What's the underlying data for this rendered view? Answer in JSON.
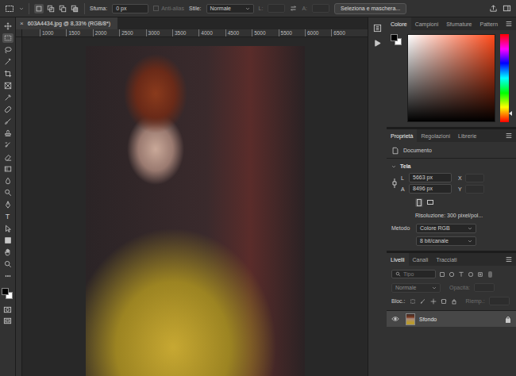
{
  "options_bar": {
    "selection_modes": [
      {
        "selected": true
      },
      {
        "selected": false
      },
      {
        "selected": false
      },
      {
        "selected": false
      }
    ],
    "feather_label": "Sfuma:",
    "feather_value": "0 px",
    "antialias": {
      "label": "Anti-alias",
      "disabled": true
    },
    "style_label": "Stile:",
    "style_value": "Normale",
    "width": {
      "label": "L:",
      "disabled": true
    },
    "height": {
      "label": "A:",
      "disabled": true
    },
    "mask_button": "Seleziona e maschera..."
  },
  "document_tab": {
    "title": "603A4434.jpg @ 8,33% (RGB/8*)",
    "close": "×"
  },
  "ruler": {
    "ticks": [
      "1000",
      "1500",
      "2000",
      "2500",
      "3000",
      "3500",
      "4000",
      "4500",
      "5000",
      "5500",
      "6000",
      "6500"
    ]
  },
  "toolbar": {
    "tools": [
      {
        "selected": false
      },
      {
        "selected": true
      },
      {
        "selected": false
      },
      {
        "selected": false
      },
      {
        "selected": false
      },
      {
        "selected": false
      },
      {
        "selected": false
      },
      {
        "selected": false
      },
      {
        "selected": false
      },
      {
        "selected": false
      },
      {
        "selected": false
      },
      {
        "selected": false
      },
      {
        "selected": false
      },
      {
        "selected": false
      },
      {
        "selected": false
      },
      {
        "selected": false
      },
      {
        "selected": false,
        "glyph": "T"
      },
      {
        "selected": false
      },
      {
        "selected": false
      },
      {
        "selected": false
      },
      {
        "selected": false
      },
      {
        "selected": false
      }
    ]
  },
  "color_panel": {
    "tabs": [
      {
        "label": "Colore",
        "selected": true
      },
      {
        "label": "Campioni",
        "selected": false
      },
      {
        "label": "Sfumature",
        "selected": false
      },
      {
        "label": "Pattern",
        "selected": false
      }
    ],
    "foreground": "#000000",
    "background": "#ffffff",
    "hue": {
      "level": 0.9
    }
  },
  "properties_panel": {
    "tabs": [
      {
        "label": "Proprietà",
        "selected": true
      },
      {
        "label": "Regolazioni",
        "selected": false
      },
      {
        "label": "Librerie",
        "selected": false
      }
    ],
    "section": "Documento",
    "canvas": {
      "title": "Tela",
      "width_label": "L",
      "width": "5663 px",
      "x_label": "X",
      "height_label": "A",
      "height": "8496 px",
      "y_label": "Y",
      "resolution": "Risoluzione: 300 pixel/pol...",
      "mode_label": "Metodo",
      "mode": "Colore RGB",
      "depth": "8 bit/canale"
    }
  },
  "layers_panel": {
    "tabs": [
      {
        "label": "Livelli",
        "selected": true
      },
      {
        "label": "Canali",
        "selected": false
      },
      {
        "label": "Tracciati",
        "selected": false
      }
    ],
    "filter_placeholder": "Tipo",
    "blend": {
      "value": "Normale",
      "disabled": true
    },
    "opacity": {
      "label": "Opacità:",
      "disabled": true
    },
    "lock_label": "Bloc.:",
    "fill": {
      "label": "Riemp.:",
      "disabled": true
    },
    "layers": [
      {
        "name": "Sfondo",
        "visible": true,
        "selected": true,
        "locked": true
      }
    ]
  }
}
